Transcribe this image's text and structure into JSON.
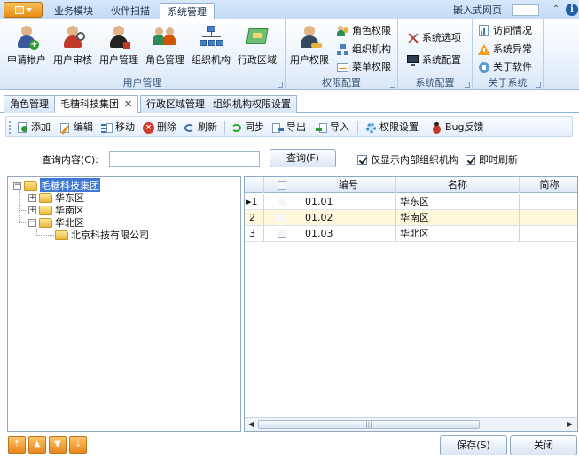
{
  "ribbon_tabs": [
    "业务模块",
    "伙伴扫描",
    "系统管理"
  ],
  "embed_label": "嵌入式网页",
  "groups": {
    "user_mgmt": {
      "label": "用户管理",
      "buttons": [
        "申请帐户",
        "用户审核",
        "用户管理",
        "角色管理",
        "组织机构",
        "行政区域"
      ]
    },
    "perm_config": {
      "label": "权限配置",
      "big": "用户权限",
      "small": [
        "角色权限",
        "组织机构",
        "菜单权限"
      ]
    },
    "sys_config": {
      "label": "系统配置",
      "small": [
        "系统选项",
        "系统配置"
      ]
    },
    "about": {
      "label": "关于系统",
      "small": [
        "访问情况",
        "系统异常",
        "关于软件"
      ]
    }
  },
  "doc_tabs": [
    "角色管理",
    "毛糖科技集团",
    "行政区域管理",
    "组织机构权限设置"
  ],
  "toolbar": [
    "添加",
    "编辑",
    "移动",
    "删除",
    "刷新",
    "同步",
    "导出",
    "导入",
    "权限设置",
    "Bug反馈"
  ],
  "query": {
    "label": "查询内容(C):",
    "value": "",
    "button": "查询(F)",
    "opt_internal": "仅显示内部组织机构",
    "opt_refresh": "即时刷新"
  },
  "tree": {
    "root": "毛糖科技集团",
    "children": [
      "华东区",
      "华南区",
      "华北区"
    ],
    "grandchild": "北京科技有限公司"
  },
  "grid": {
    "columns": [
      "编号",
      "名称",
      "简称"
    ],
    "rows": [
      {
        "num": "1",
        "code": "01.01",
        "name": "华东区"
      },
      {
        "num": "2",
        "code": "01.02",
        "name": "华南区"
      },
      {
        "num": "3",
        "code": "01.03",
        "name": "华北区"
      }
    ]
  },
  "buttons": {
    "save": "保存(S)",
    "close": "关闭"
  },
  "colors": {
    "accent": "#3d78d6",
    "selected_row": "#fff8dc",
    "orange": "#e8861c"
  }
}
